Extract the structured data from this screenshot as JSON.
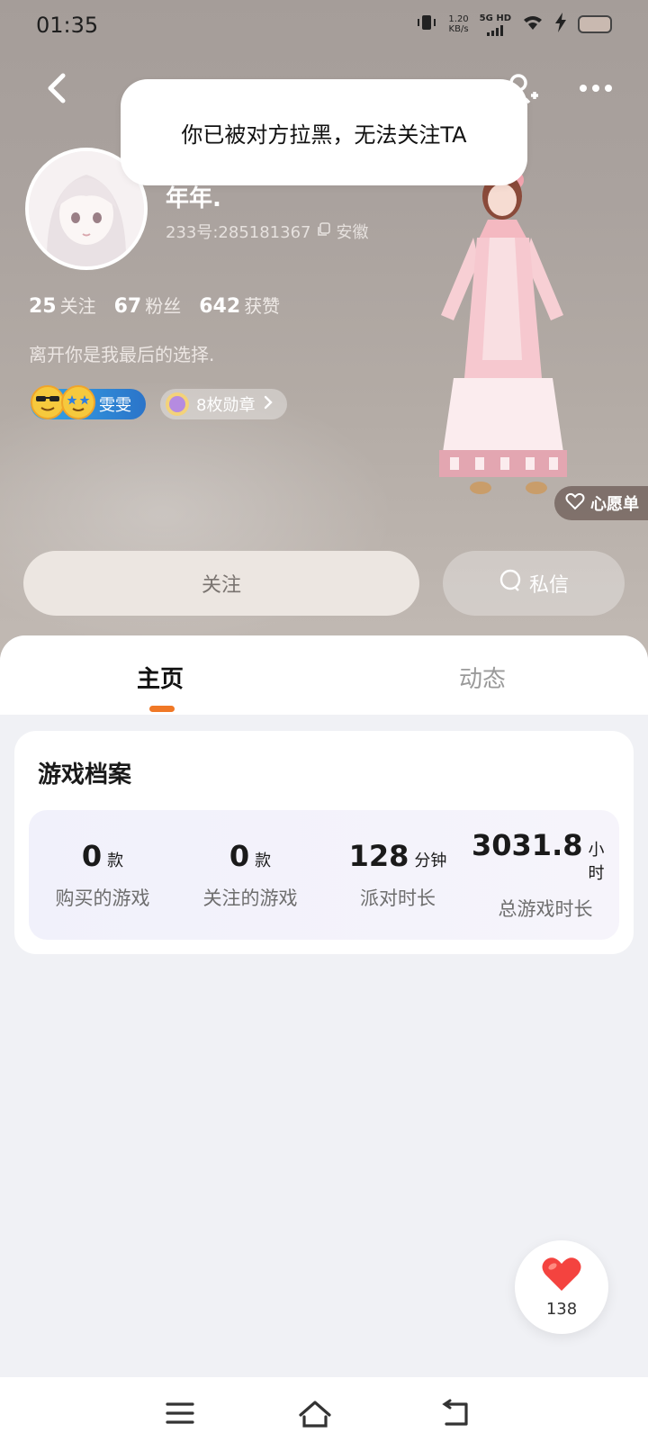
{
  "status_bar": {
    "time": "01:35",
    "net_speed_value": "1.20",
    "net_speed_unit": "KB/s",
    "signal": "5G HD"
  },
  "header": {
    "back_icon": "chevron-left-icon",
    "add_user_icon": "add-user-icon",
    "more_icon": "more-dots-icon"
  },
  "toast": {
    "message": "你已被对方拉黑，无法关注TA"
  },
  "profile": {
    "nickname": "年年.",
    "uid": "233号:285181367",
    "location": "安徽",
    "bio": "离开你是我最后的选择.",
    "stats": [
      {
        "value": "25",
        "label": "关注"
      },
      {
        "value": "67",
        "label": "粉丝"
      },
      {
        "value": "642",
        "label": "获赞"
      }
    ],
    "badge_name": "雯雯",
    "medals": "8枚勋章"
  },
  "wishlist": {
    "label": "心愿单"
  },
  "actions": {
    "follow_label": "关注",
    "message_label": "私信"
  },
  "tabs": [
    {
      "label": "主页",
      "active": true
    },
    {
      "label": "动态",
      "active": false
    }
  ],
  "game_profile": {
    "title": "游戏档案",
    "metrics": [
      {
        "value": "0",
        "unit": "款",
        "label": "购买的游戏"
      },
      {
        "value": "0",
        "unit": "款",
        "label": "关注的游戏"
      },
      {
        "value": "128",
        "unit": "分钟",
        "label": "派对时长"
      },
      {
        "value": "3031.8",
        "unit": "小时",
        "label": "总游戏时长"
      }
    ]
  },
  "like_button": {
    "count": "138",
    "color": "#f4433f"
  },
  "colors": {
    "accent": "#f07826",
    "toast_bg": "#ffffff"
  }
}
